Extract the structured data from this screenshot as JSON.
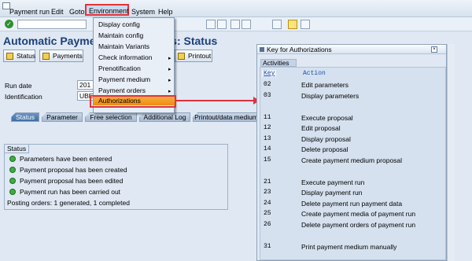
{
  "menubar": {
    "items": [
      "Payment run",
      "Edit",
      "Goto",
      "Environment",
      "System",
      "Help"
    ]
  },
  "page_title": "Automatic Payment Transactions: Status",
  "app_buttons": [
    "Status",
    "Payments",
    "Printout"
  ],
  "fields": {
    "run_date_label": "Run date",
    "run_date_value": "201",
    "identification_label": "Identification",
    "identification_value": "UBE"
  },
  "tabs": [
    "Status",
    "Parameter",
    "Free selection",
    "Additional Log",
    "Printout/data medium"
  ],
  "status_group": {
    "title": "Status",
    "items": [
      "Parameters have been entered",
      "Payment proposal has been created",
      "Payment proposal has been edited",
      "Payment run has been carried out"
    ],
    "summary": "Posting orders: 1 generated, 1 completed"
  },
  "env_menu": {
    "items": [
      "Display config",
      "Maintain config",
      "Maintain Variants",
      "Check information",
      "Prenotification",
      "Payment medium",
      "Payment orders",
      "Authorizations"
    ]
  },
  "popup": {
    "title": "Key for Authorizations",
    "section": "Activities",
    "header_key": "Key",
    "header_action": "Action",
    "rows": [
      {
        "code": "02",
        "action": "Edit parameters"
      },
      {
        "code": "03",
        "action": "Display parameters"
      },
      {
        "code": "11",
        "action": "Execute proposal"
      },
      {
        "code": "12",
        "action": "Edit proposal"
      },
      {
        "code": "13",
        "action": "Display proposal"
      },
      {
        "code": "14",
        "action": "Delete proposal"
      },
      {
        "code": "15",
        "action": "Create payment medium proposal"
      },
      {
        "code": "21",
        "action": "Execute payment run"
      },
      {
        "code": "23",
        "action": "Display payment run"
      },
      {
        "code": "24",
        "action": "Delete payment run payment data"
      },
      {
        "code": "25",
        "action": "Create payment media of payment run"
      },
      {
        "code": "26",
        "action": "Delete payment orders of payment run"
      },
      {
        "code": "31",
        "action": "Print payment medium manually"
      }
    ]
  },
  "colors": {
    "highlight": "#ef8c0f",
    "annotation": "#e0333b",
    "title": "#1c3f78"
  }
}
